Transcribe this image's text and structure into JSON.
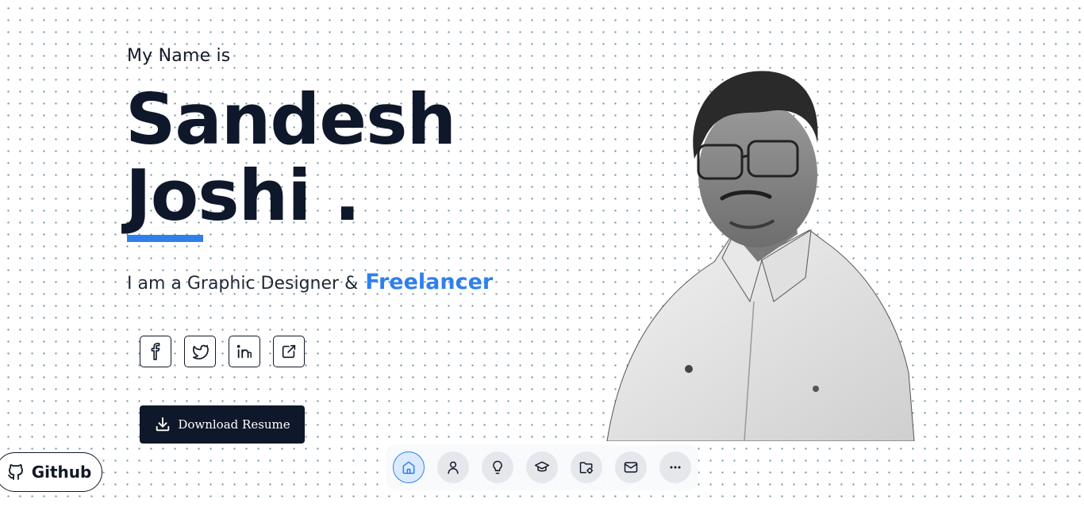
{
  "hero": {
    "intro": "My Name is",
    "first_name": "Sandesh",
    "last_name": "Joshi .",
    "tagline_prefix": "I am a Graphic Designer &",
    "tagline_accent": "Freelancer"
  },
  "socials": [
    {
      "icon": "facebook-icon"
    },
    {
      "icon": "twitter-icon"
    },
    {
      "icon": "linkedin-icon"
    },
    {
      "icon": "external-link-icon"
    }
  ],
  "actions": {
    "download_label": "Download Resume",
    "github_label": "Github"
  },
  "dock": {
    "items": [
      {
        "icon": "home-icon",
        "active": true
      },
      {
        "icon": "user-icon"
      },
      {
        "icon": "lightbulb-icon"
      },
      {
        "icon": "graduation-cap-icon"
      },
      {
        "icon": "folder-icon"
      },
      {
        "icon": "mail-icon"
      },
      {
        "icon": "more-icon"
      }
    ]
  },
  "colors": {
    "accent": "#2f80ed",
    "dark": "#0f172a",
    "dot_grid": "#6f8fa0"
  }
}
